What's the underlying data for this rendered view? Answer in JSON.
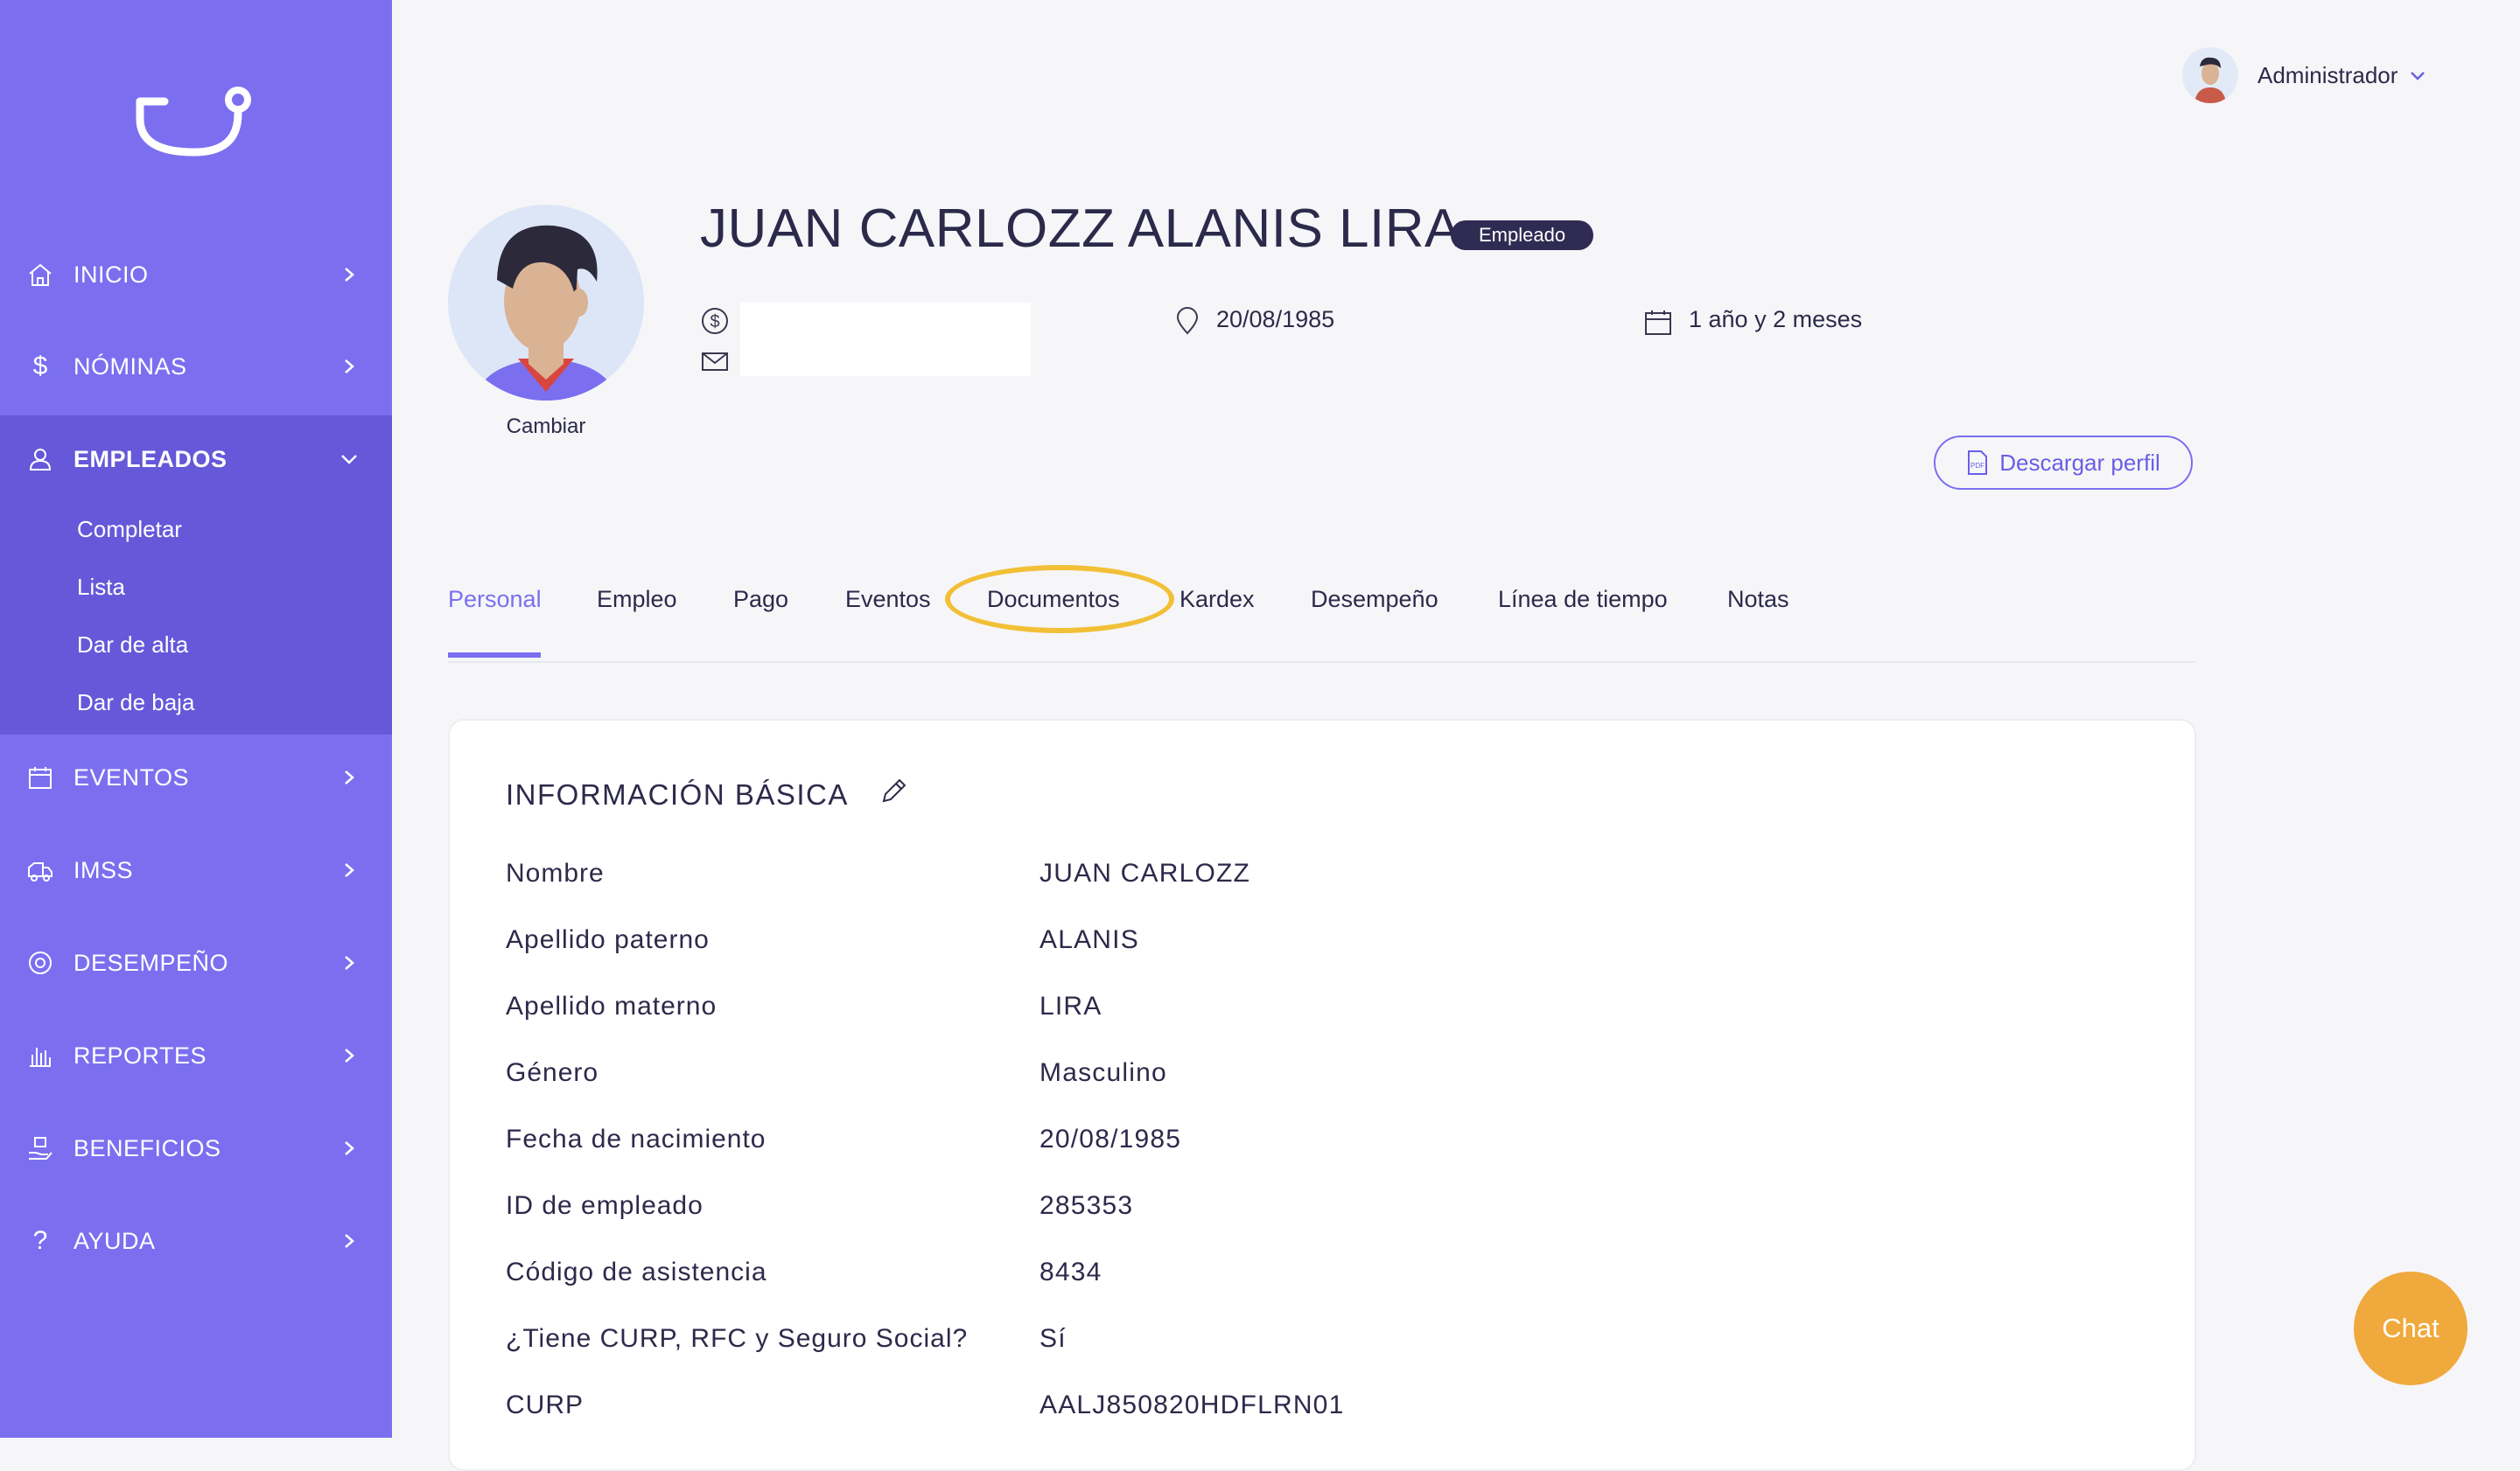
{
  "sidebar": {
    "items": [
      {
        "label": "INICIO",
        "icon": "home-icon"
      },
      {
        "label": "NÓMINAS",
        "icon": "dollar-icon"
      },
      {
        "label": "EMPLEADOS",
        "icon": "user-icon",
        "active": true,
        "sub_items": [
          "Completar",
          "Lista",
          "Dar de alta",
          "Dar de baja"
        ]
      },
      {
        "label": "EVENTOS",
        "icon": "calendar-icon"
      },
      {
        "label": "IMSS",
        "icon": "ambulance-icon"
      },
      {
        "label": "DESEMPEÑO",
        "icon": "target-icon"
      },
      {
        "label": "REPORTES",
        "icon": "bar-chart-icon"
      },
      {
        "label": "BENEFICIOS",
        "icon": "gift-hand-icon"
      },
      {
        "label": "AYUDA",
        "icon": "question-icon"
      }
    ]
  },
  "header": {
    "user_name": "Administrador"
  },
  "profile": {
    "name": "JUAN CARLOZZ ALANIS LIRA",
    "role_badge": "Empleado",
    "change_photo": "Cambiar",
    "birth_date": "20/08/1985",
    "seniority": "1 año y 2 meses",
    "download_label": "Descargar perfil"
  },
  "tabs": [
    {
      "label": "Personal",
      "active": true
    },
    {
      "label": "Empleo"
    },
    {
      "label": "Pago"
    },
    {
      "label": "Eventos"
    },
    {
      "label": "Documentos",
      "highlighted": true
    },
    {
      "label": "Kardex"
    },
    {
      "label": "Desempeño"
    },
    {
      "label": "Línea de tiempo"
    },
    {
      "label": "Notas"
    }
  ],
  "basic_info": {
    "title": "INFORMACIÓN BÁSICA",
    "rows": [
      {
        "label": "Nombre",
        "value": "JUAN CARLOZZ"
      },
      {
        "label": "Apellido paterno",
        "value": "ALANIS"
      },
      {
        "label": "Apellido materno",
        "value": "LIRA"
      },
      {
        "label": "Género",
        "value": "Masculino"
      },
      {
        "label": "Fecha de nacimiento",
        "value": "20/08/1985"
      },
      {
        "label": "ID de empleado",
        "value": "285353"
      },
      {
        "label": "Código de asistencia",
        "value": "8434"
      },
      {
        "label": "¿Tiene CURP, RFC y Seguro Social?",
        "value": "Sí"
      },
      {
        "label": "CURP",
        "value": "AALJ850820HDFLRN01"
      }
    ]
  },
  "chat": {
    "label": "Chat"
  },
  "colors": {
    "sidebar": "#7b6ff0",
    "sidebar_active": "#6558d9",
    "accent": "#7b6ff0",
    "badge": "#2f2b52",
    "highlight": "#f2c037",
    "chat": "#f0a93c"
  }
}
